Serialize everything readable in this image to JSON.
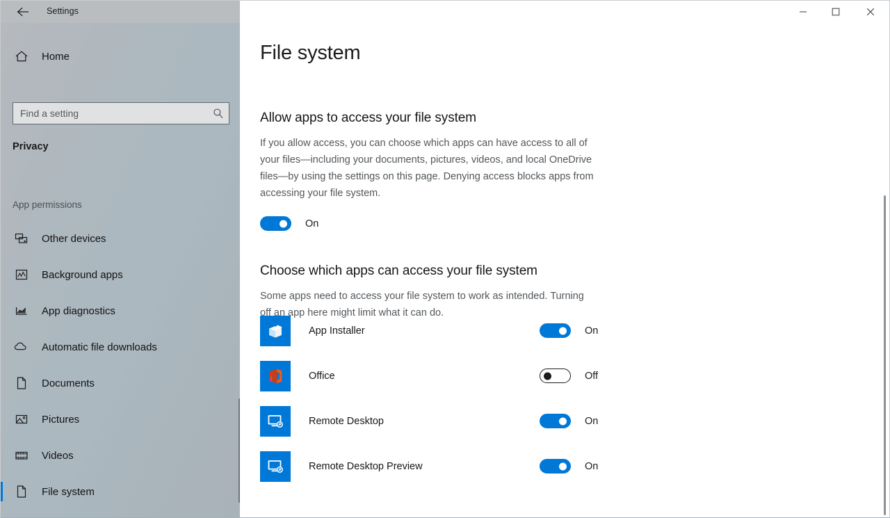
{
  "window": {
    "title": "Settings",
    "back_icon": "back-arrow-icon",
    "controls": {
      "minimize": "minimize-icon",
      "maximize": "maximize-icon",
      "close": "close-icon"
    }
  },
  "accent_color": "#0078d7",
  "sidebar": {
    "home": {
      "label": "Home",
      "icon": "home-icon"
    },
    "search": {
      "placeholder": "Find a setting",
      "value": "",
      "icon": "search-icon"
    },
    "category": "Privacy",
    "group_label": "App permissions",
    "items": [
      {
        "label": "Other devices",
        "icon": "other-devices-icon",
        "selected": false
      },
      {
        "label": "Background apps",
        "icon": "background-apps-icon",
        "selected": false
      },
      {
        "label": "App diagnostics",
        "icon": "app-diagnostics-icon",
        "selected": false
      },
      {
        "label": "Automatic file downloads",
        "icon": "cloud-download-icon",
        "selected": false
      },
      {
        "label": "Documents",
        "icon": "document-icon",
        "selected": false
      },
      {
        "label": "Pictures",
        "icon": "pictures-icon",
        "selected": false
      },
      {
        "label": "Videos",
        "icon": "videos-icon",
        "selected": false
      },
      {
        "label": "File system",
        "icon": "document-icon",
        "selected": true
      }
    ]
  },
  "main": {
    "page_title": "File system",
    "allow_section": {
      "heading": "Allow apps to access your file system",
      "body": "If you allow access, you can choose which apps can have access to all of your files—including your documents, pictures, videos, and local OneDrive files—by using the settings on this page. Denying access blocks apps from accessing your file system.",
      "toggle_state": "On",
      "toggle_on": true
    },
    "choose_section": {
      "heading": "Choose which apps can access your file system",
      "body": "Some apps need to access your file system to work as intended. Turning off an app here might limit what it can do."
    },
    "apps": [
      {
        "name": "App Installer",
        "icon": "app-installer-icon",
        "toggle_state": "On",
        "toggle_on": true
      },
      {
        "name": "Office",
        "icon": "office-icon",
        "toggle_state": "Off",
        "toggle_on": false
      },
      {
        "name": "Remote Desktop",
        "icon": "remote-desktop-icon",
        "toggle_state": "On",
        "toggle_on": true
      },
      {
        "name": "Remote Desktop Preview",
        "icon": "remote-desktop-icon",
        "toggle_state": "On",
        "toggle_on": true
      }
    ]
  }
}
